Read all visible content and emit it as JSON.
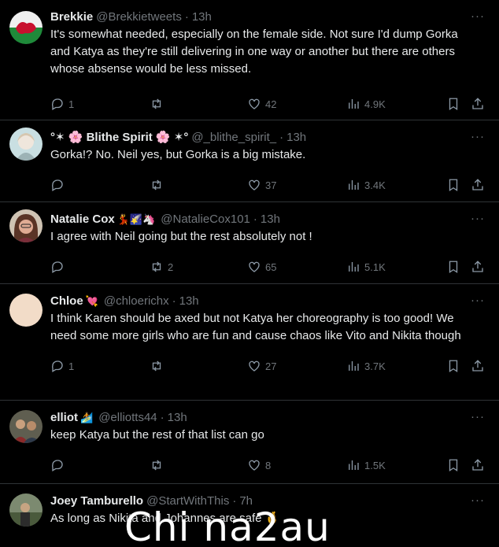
{
  "tweets": [
    {
      "name": "Brekkie",
      "name_emoji": "",
      "handle": "@Brekkietweets",
      "time": "13h",
      "text": "It's somewhat needed, especially on the female side.   Not sure I'd dump Gorka and Katya as they're still delivering in one way or another but there are others whose absense would be less missed.",
      "replies": "1",
      "retweets": "",
      "likes": "42",
      "views": "4.9K",
      "avatar_colors": [
        "#1f8a3a",
        "#f0f0f0",
        "#c8102e"
      ]
    },
    {
      "name": "°✶ 🌸 Blithe Spirit 🌸 ✶°",
      "name_emoji": "",
      "handle": "@_blithe_spirit_",
      "time": "13h",
      "text": "Gorka!? No. Neil yes, but Gorka is a big mistake.",
      "replies": "",
      "retweets": "",
      "likes": "37",
      "views": "3.4K",
      "avatar_colors": [
        "#b9d7dc",
        "#e8e0d8",
        "#6c8a8f"
      ]
    },
    {
      "name": "Natalie Cox",
      "name_emoji": "💃🌠🦄",
      "handle": "@NatalieCox101",
      "time": "13h",
      "text": "I agree with Neil going but the rest absolutely not !",
      "replies": "",
      "retweets": "2",
      "likes": "65",
      "views": "5.1K",
      "avatar_colors": [
        "#5a3a2a",
        "#d9a690",
        "#8a5a48"
      ]
    },
    {
      "name": "Chloe",
      "name_emoji": "💘",
      "handle": "@chloerichx",
      "time": "13h",
      "text": "I think Karen should be axed but not Katya her choreography is too good! We need some more girls who are fun and cause chaos like Vito and Nikita though",
      "replies": "1",
      "retweets": "",
      "likes": "27",
      "views": "3.7K",
      "avatar_colors": [
        "#f2dcc8",
        "#f2dcc8",
        "#f2dcc8"
      ]
    },
    {
      "name": "elliot",
      "name_emoji": "🏄",
      "handle": "@elliotts44",
      "time": "13h",
      "text": "keep Katya but the rest of that list can go",
      "replies": "",
      "retweets": "",
      "likes": "8",
      "views": "1.5K",
      "avatar_colors": [
        "#6a6a5a",
        "#c0a080",
        "#3a3a32"
      ]
    },
    {
      "name": "Joey Tamburello",
      "name_emoji": "",
      "handle": "@StartWithThis",
      "time": "7h",
      "text": "As long as Nikita and Johannes are safe 🤞",
      "replies": "",
      "retweets": "",
      "likes": "",
      "views": "",
      "avatar_colors": [
        "#5a6a50",
        "#8a9a7a",
        "#3a4a30"
      ]
    }
  ],
  "more_label": "···",
  "watermark": "Chi na2au"
}
